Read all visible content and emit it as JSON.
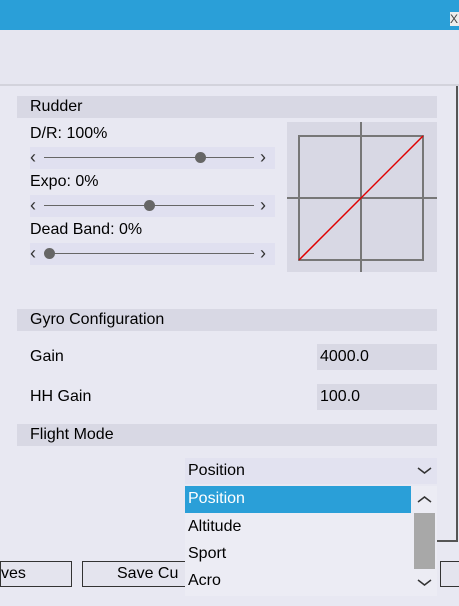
{
  "window": {
    "close_glyph": "X"
  },
  "rudder": {
    "header": "Rudder",
    "dr_label": "D/R: 100%",
    "dr_value": 0.76,
    "expo_label": "Expo: 0%",
    "expo_value": 0.5,
    "deadband_label": "Dead Band: 0%",
    "deadband_value": 0.0
  },
  "gyro": {
    "header": "Gyro Configuration",
    "gain_label": "Gain",
    "gain_value": "4000.0",
    "hh_gain_label": "HH Gain",
    "hh_gain_value": "100.0"
  },
  "flight_mode": {
    "header": "Flight Mode",
    "selected": "Position",
    "options": [
      "Position",
      "Altitude",
      "Sport",
      "Acro"
    ]
  },
  "buttons": {
    "left_partial": "ves",
    "save_partial": "Save Cu"
  },
  "colors": {
    "accent": "#2a9fd8",
    "curve": "#e00000"
  }
}
